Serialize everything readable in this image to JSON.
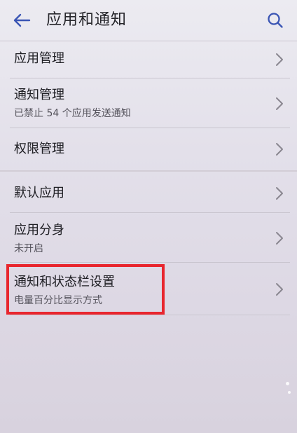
{
  "header": {
    "title": "应用和通知",
    "back_icon": "back-arrow-icon",
    "search_icon": "search-icon",
    "accent_color": "#3a55b4"
  },
  "items": [
    {
      "title": "应用管理",
      "subtitle": ""
    },
    {
      "title": "通知管理",
      "subtitle": "已禁止 54 个应用发送通知"
    },
    {
      "title": "权限管理",
      "subtitle": ""
    },
    {
      "title": "默认应用",
      "subtitle": ""
    },
    {
      "title": "应用分身",
      "subtitle": "未开启"
    },
    {
      "title": "通知和状态栏设置",
      "subtitle": "电量百分比显示方式"
    }
  ],
  "highlight": {
    "color": "#e8262e"
  }
}
